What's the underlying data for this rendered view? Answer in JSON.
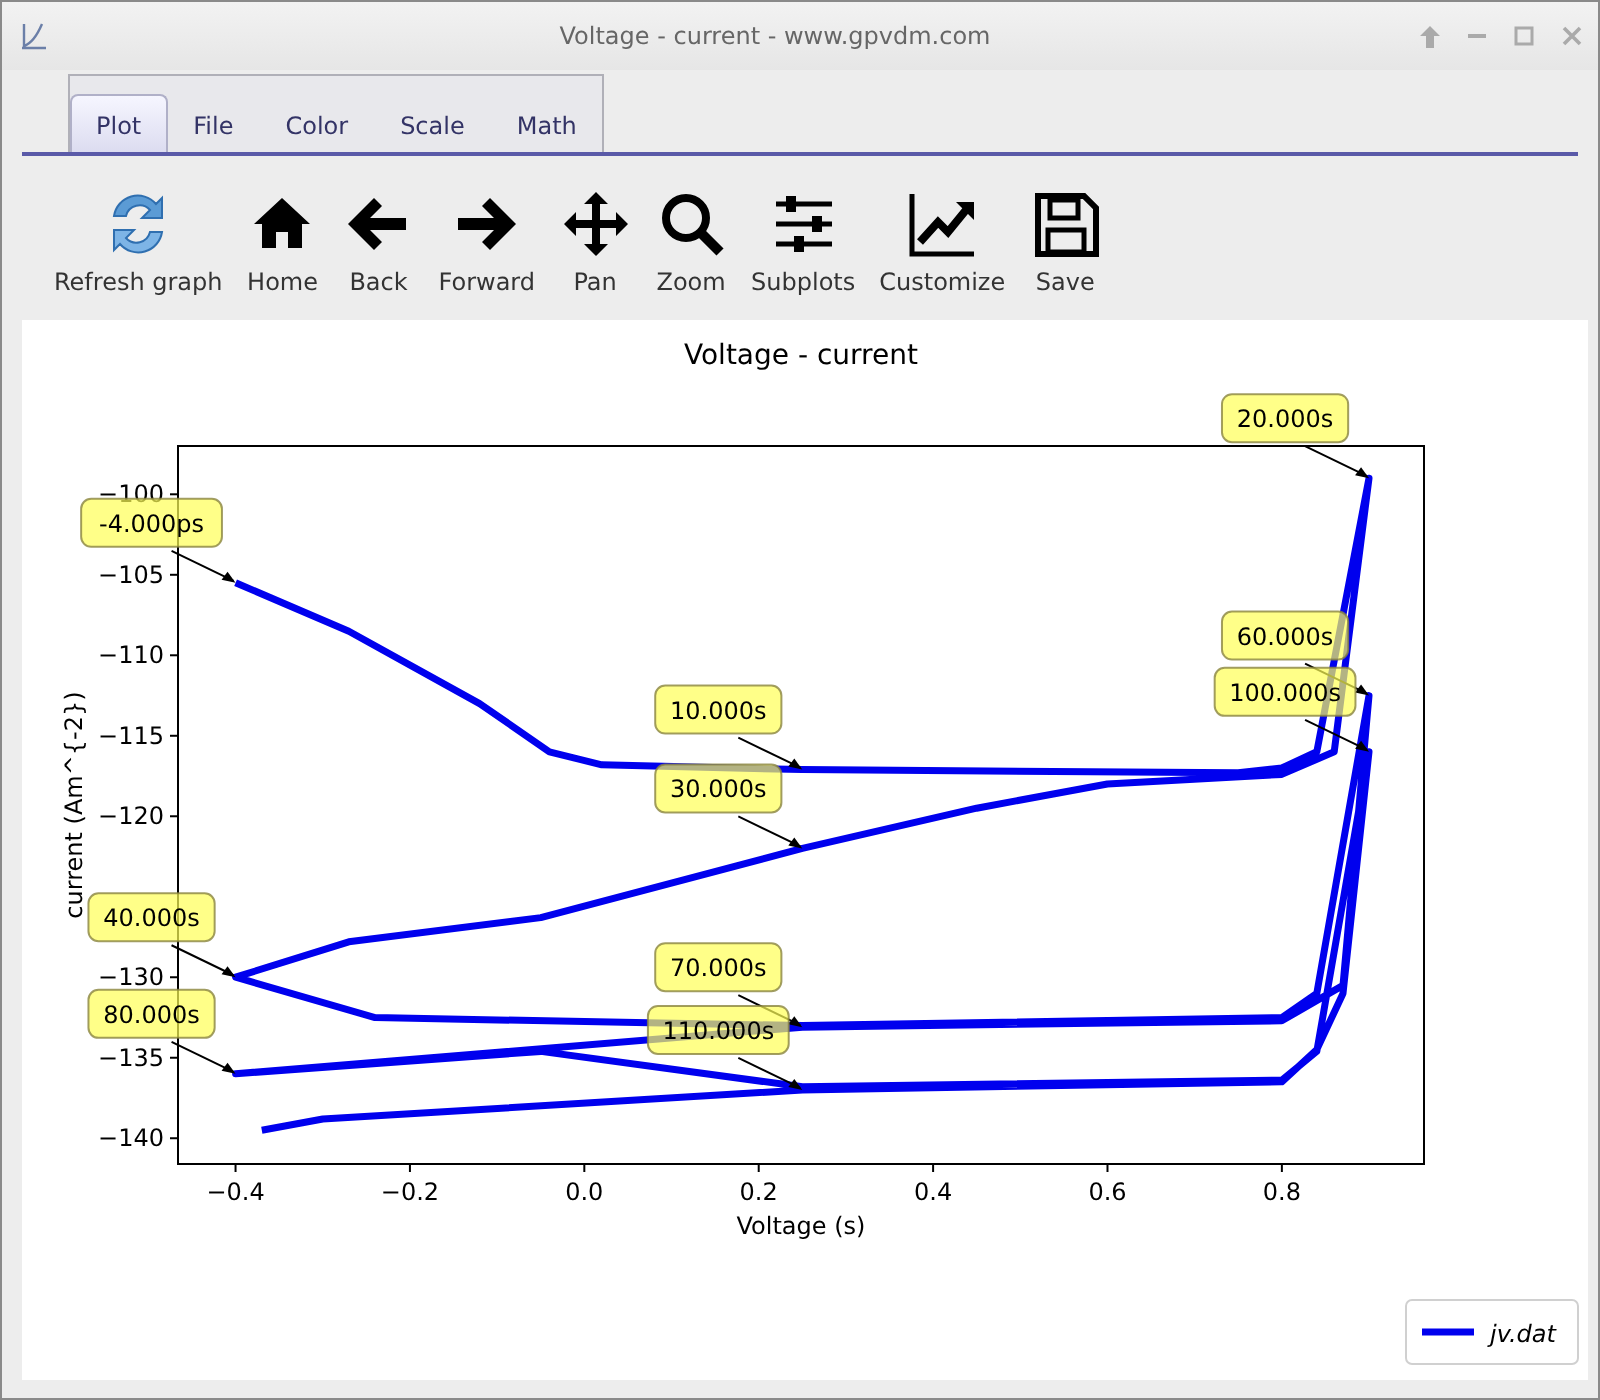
{
  "window": {
    "title": "Voltage - current - www.gpvdm.com"
  },
  "tabs": [
    {
      "label": "Plot",
      "selected": true
    },
    {
      "label": "File",
      "selected": false
    },
    {
      "label": "Color",
      "selected": false
    },
    {
      "label": "Scale",
      "selected": false
    },
    {
      "label": "Math",
      "selected": false
    }
  ],
  "toolbar": [
    "Refresh graph",
    "Home",
    "Back",
    "Forward",
    "Pan",
    "Zoom",
    "Subplots",
    "Customize",
    "Save"
  ],
  "plot": {
    "chart_data": {
      "type": "line",
      "title": "Voltage - current",
      "xlabel": "Voltage (s)",
      "ylabel": "current (Am^{-2})",
      "x": [
        -0.4,
        -0.27,
        -0.12,
        -0.04,
        0.02,
        0.25,
        0.75,
        0.8,
        0.84,
        0.9,
        0.86,
        0.8,
        0.6,
        0.45,
        0.25,
        -0.05,
        -0.27,
        -0.4,
        -0.24,
        0.25,
        0.8,
        0.84,
        0.9,
        0.87,
        0.8,
        0.25,
        -0.4,
        -0.05,
        0.25,
        0.8,
        0.84,
        0.9,
        0.87,
        0.84,
        0.8,
        0.25,
        -0.3,
        -0.37
      ],
      "series": [
        {
          "name": "jv.dat",
          "color": "#0000ee",
          "values": [
            -105.5,
            -108.5,
            -113,
            -116,
            -116.8,
            -117.1,
            -117.3,
            -117,
            -116,
            -99,
            -116,
            -117.4,
            -118,
            -119.5,
            -122,
            -126.3,
            -127.8,
            -130,
            -132.5,
            -133,
            -132.5,
            -131,
            -112.5,
            -130.5,
            -132.7,
            -133.1,
            -136,
            -134.6,
            -136.8,
            -136.4,
            -134.6,
            -116,
            -131,
            -134.5,
            -136.5,
            -137,
            -138.8,
            -139.5
          ]
        }
      ],
      "xlim": [
        -0.466,
        0.963
      ],
      "ylim": [
        -141.6,
        -97
      ],
      "xticks": [
        {
          "value": -0.4,
          "label": "−0.4"
        },
        {
          "value": -0.2,
          "label": "−0.2"
        },
        {
          "value": 0,
          "label": "0.0"
        },
        {
          "value": 0.2,
          "label": "0.2"
        },
        {
          "value": 0.4,
          "label": "0.4"
        },
        {
          "value": 0.6,
          "label": "0.6"
        },
        {
          "value": 0.8,
          "label": "0.8"
        }
      ],
      "yticks": [
        {
          "value": -100,
          "label": "−100"
        },
        {
          "value": -105,
          "label": "−105"
        },
        {
          "value": -110,
          "label": "−110"
        },
        {
          "value": -115,
          "label": "−115"
        },
        {
          "value": -120,
          "label": "−120"
        },
        {
          "value": -130,
          "label": "−130"
        },
        {
          "value": -135,
          "label": "−135"
        },
        {
          "value": -140,
          "label": "−140"
        }
      ],
      "annotations": [
        {
          "text": "-4.000ps",
          "x": -0.4,
          "y": -105.5
        },
        {
          "text": "10.000s",
          "x": 0.25,
          "y": -117.1
        },
        {
          "text": "20.000s",
          "x": 0.9,
          "y": -99
        },
        {
          "text": "30.000s",
          "x": 0.25,
          "y": -122
        },
        {
          "text": "40.000s",
          "x": -0.4,
          "y": -130
        },
        {
          "text": "60.000s",
          "x": 0.9,
          "y": -112.5
        },
        {
          "text": "70.000s",
          "x": 0.25,
          "y": -133.1
        },
        {
          "text": "80.000s",
          "x": -0.4,
          "y": -136
        },
        {
          "text": "100.000s",
          "x": 0.9,
          "y": -116
        },
        {
          "text": "110.000s",
          "x": 0.25,
          "y": -137
        }
      ]
    }
  }
}
